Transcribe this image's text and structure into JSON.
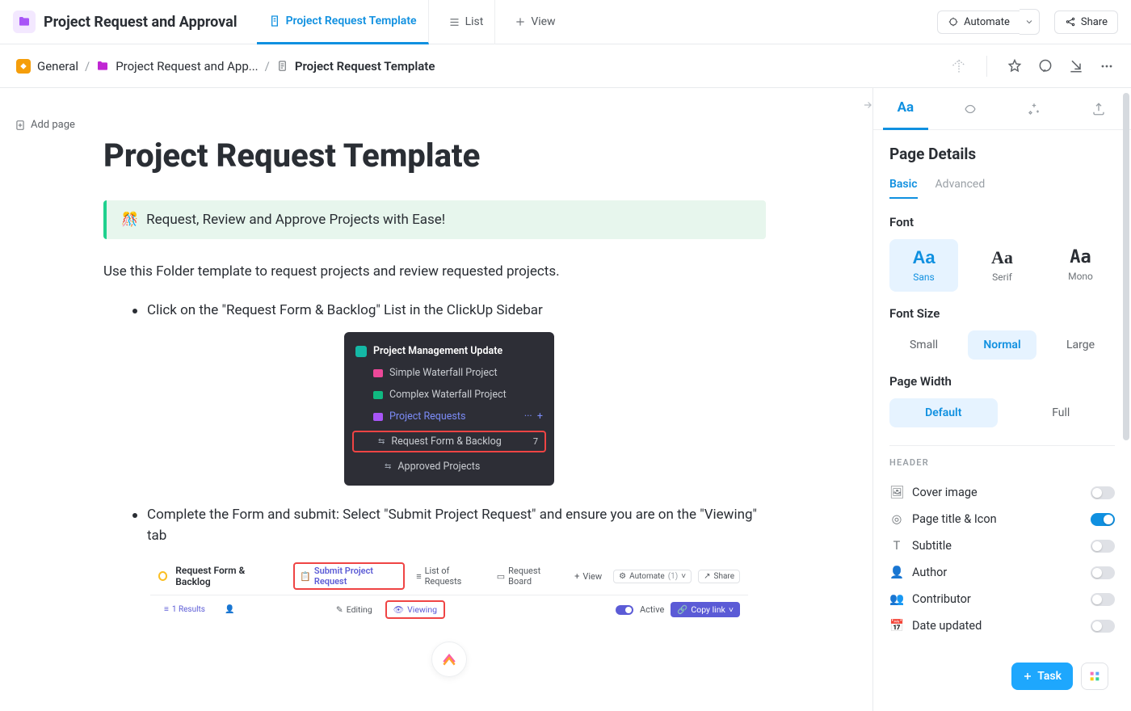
{
  "topbar": {
    "space_title": "Project Request and Approval",
    "tabs": [
      {
        "label": "Project Request Template",
        "active": true
      },
      {
        "label": "List"
      },
      {
        "label": "View"
      }
    ],
    "automate_label": "Automate",
    "share_label": "Share"
  },
  "breadcrumb": {
    "items": [
      "General",
      "Project Request and App...",
      "Project Request Template"
    ]
  },
  "sidebar": {
    "add_page": "Add page"
  },
  "doc": {
    "title": "Project Request Template",
    "callout_emoji": "🎊",
    "callout": "Request, Review and Approve Projects with Ease!",
    "intro": "Use this Folder template to request projects and review requested projects.",
    "bullet1": "Click on the \"Request Form & Backlog\" List in the ClickUp Sidebar",
    "bullet2": "Complete the Form and submit: Select \"Submit Project Request\" and ensure you are on the \"Viewing\" tab"
  },
  "shot1": {
    "header": "Project Management Update",
    "rows": [
      "Simple Waterfall Project",
      "Complex Waterfall Project",
      "Project Requests",
      "Request Form & Backlog",
      "Approved Projects"
    ],
    "count": "7"
  },
  "shot2": {
    "title": "Request Form & Backlog",
    "tab_submit": "Submit Project Request",
    "tab_list": "List of Requests",
    "tab_board": "Request Board",
    "tab_view": "View",
    "automate": "Automate",
    "automate_n": "(1)",
    "share": "Share",
    "results": "1 Results",
    "editing": "Editing",
    "viewing": "Viewing",
    "active": "Active",
    "copy": "Copy link"
  },
  "rightpanel": {
    "title": "Page Details",
    "subtabs": [
      "Basic",
      "Advanced"
    ],
    "font_label": "Font",
    "fonts": [
      {
        "sample": "Aa",
        "name": "Sans",
        "active": true
      },
      {
        "sample": "Aa",
        "name": "Serif"
      },
      {
        "sample": "Aa",
        "name": "Mono"
      }
    ],
    "size_label": "Font Size",
    "sizes": [
      "Small",
      "Normal",
      "Large"
    ],
    "width_label": "Page Width",
    "widths": [
      "Default",
      "Full"
    ],
    "header_label": "HEADER",
    "toggles": [
      {
        "label": "Cover image",
        "on": false
      },
      {
        "label": "Page title & Icon",
        "on": true
      },
      {
        "label": "Subtitle",
        "on": false
      },
      {
        "label": "Author",
        "on": false
      },
      {
        "label": "Contributor",
        "on": false
      },
      {
        "label": "Date updated",
        "on": false
      }
    ]
  },
  "floaters": {
    "task": "Task"
  }
}
